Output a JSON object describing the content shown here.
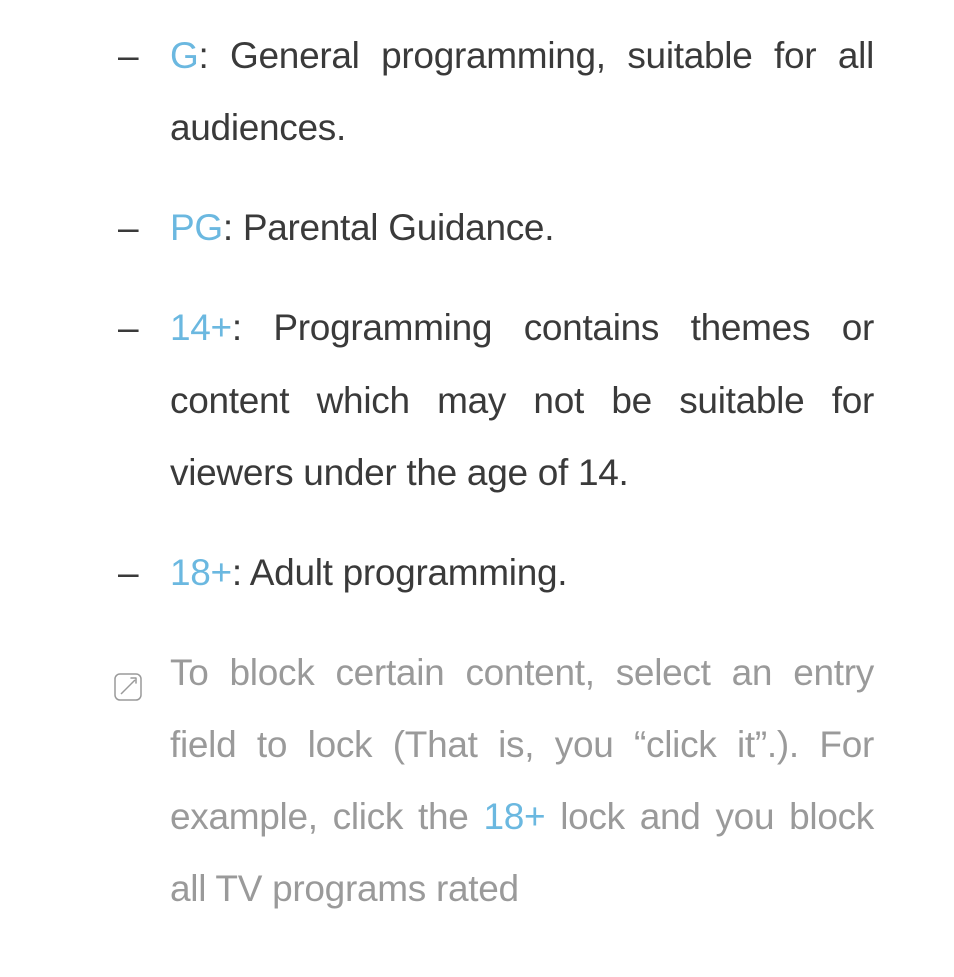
{
  "ratings": [
    {
      "label": "G",
      "description": ": General programming, suitable for all audiences."
    },
    {
      "label": "PG",
      "description": ": Parental Guidance."
    },
    {
      "label": "14+",
      "description": ": Programming contains themes or content which may not be suitable for viewers under the age of 14."
    },
    {
      "label": "18+",
      "description": ": Adult programming."
    }
  ],
  "note": {
    "part1": "To block certain content, select an entry field to lock (That is, you “click it”.). For example, click the ",
    "inline_label": "18+",
    "part2": " lock and you block all TV programs rated"
  }
}
